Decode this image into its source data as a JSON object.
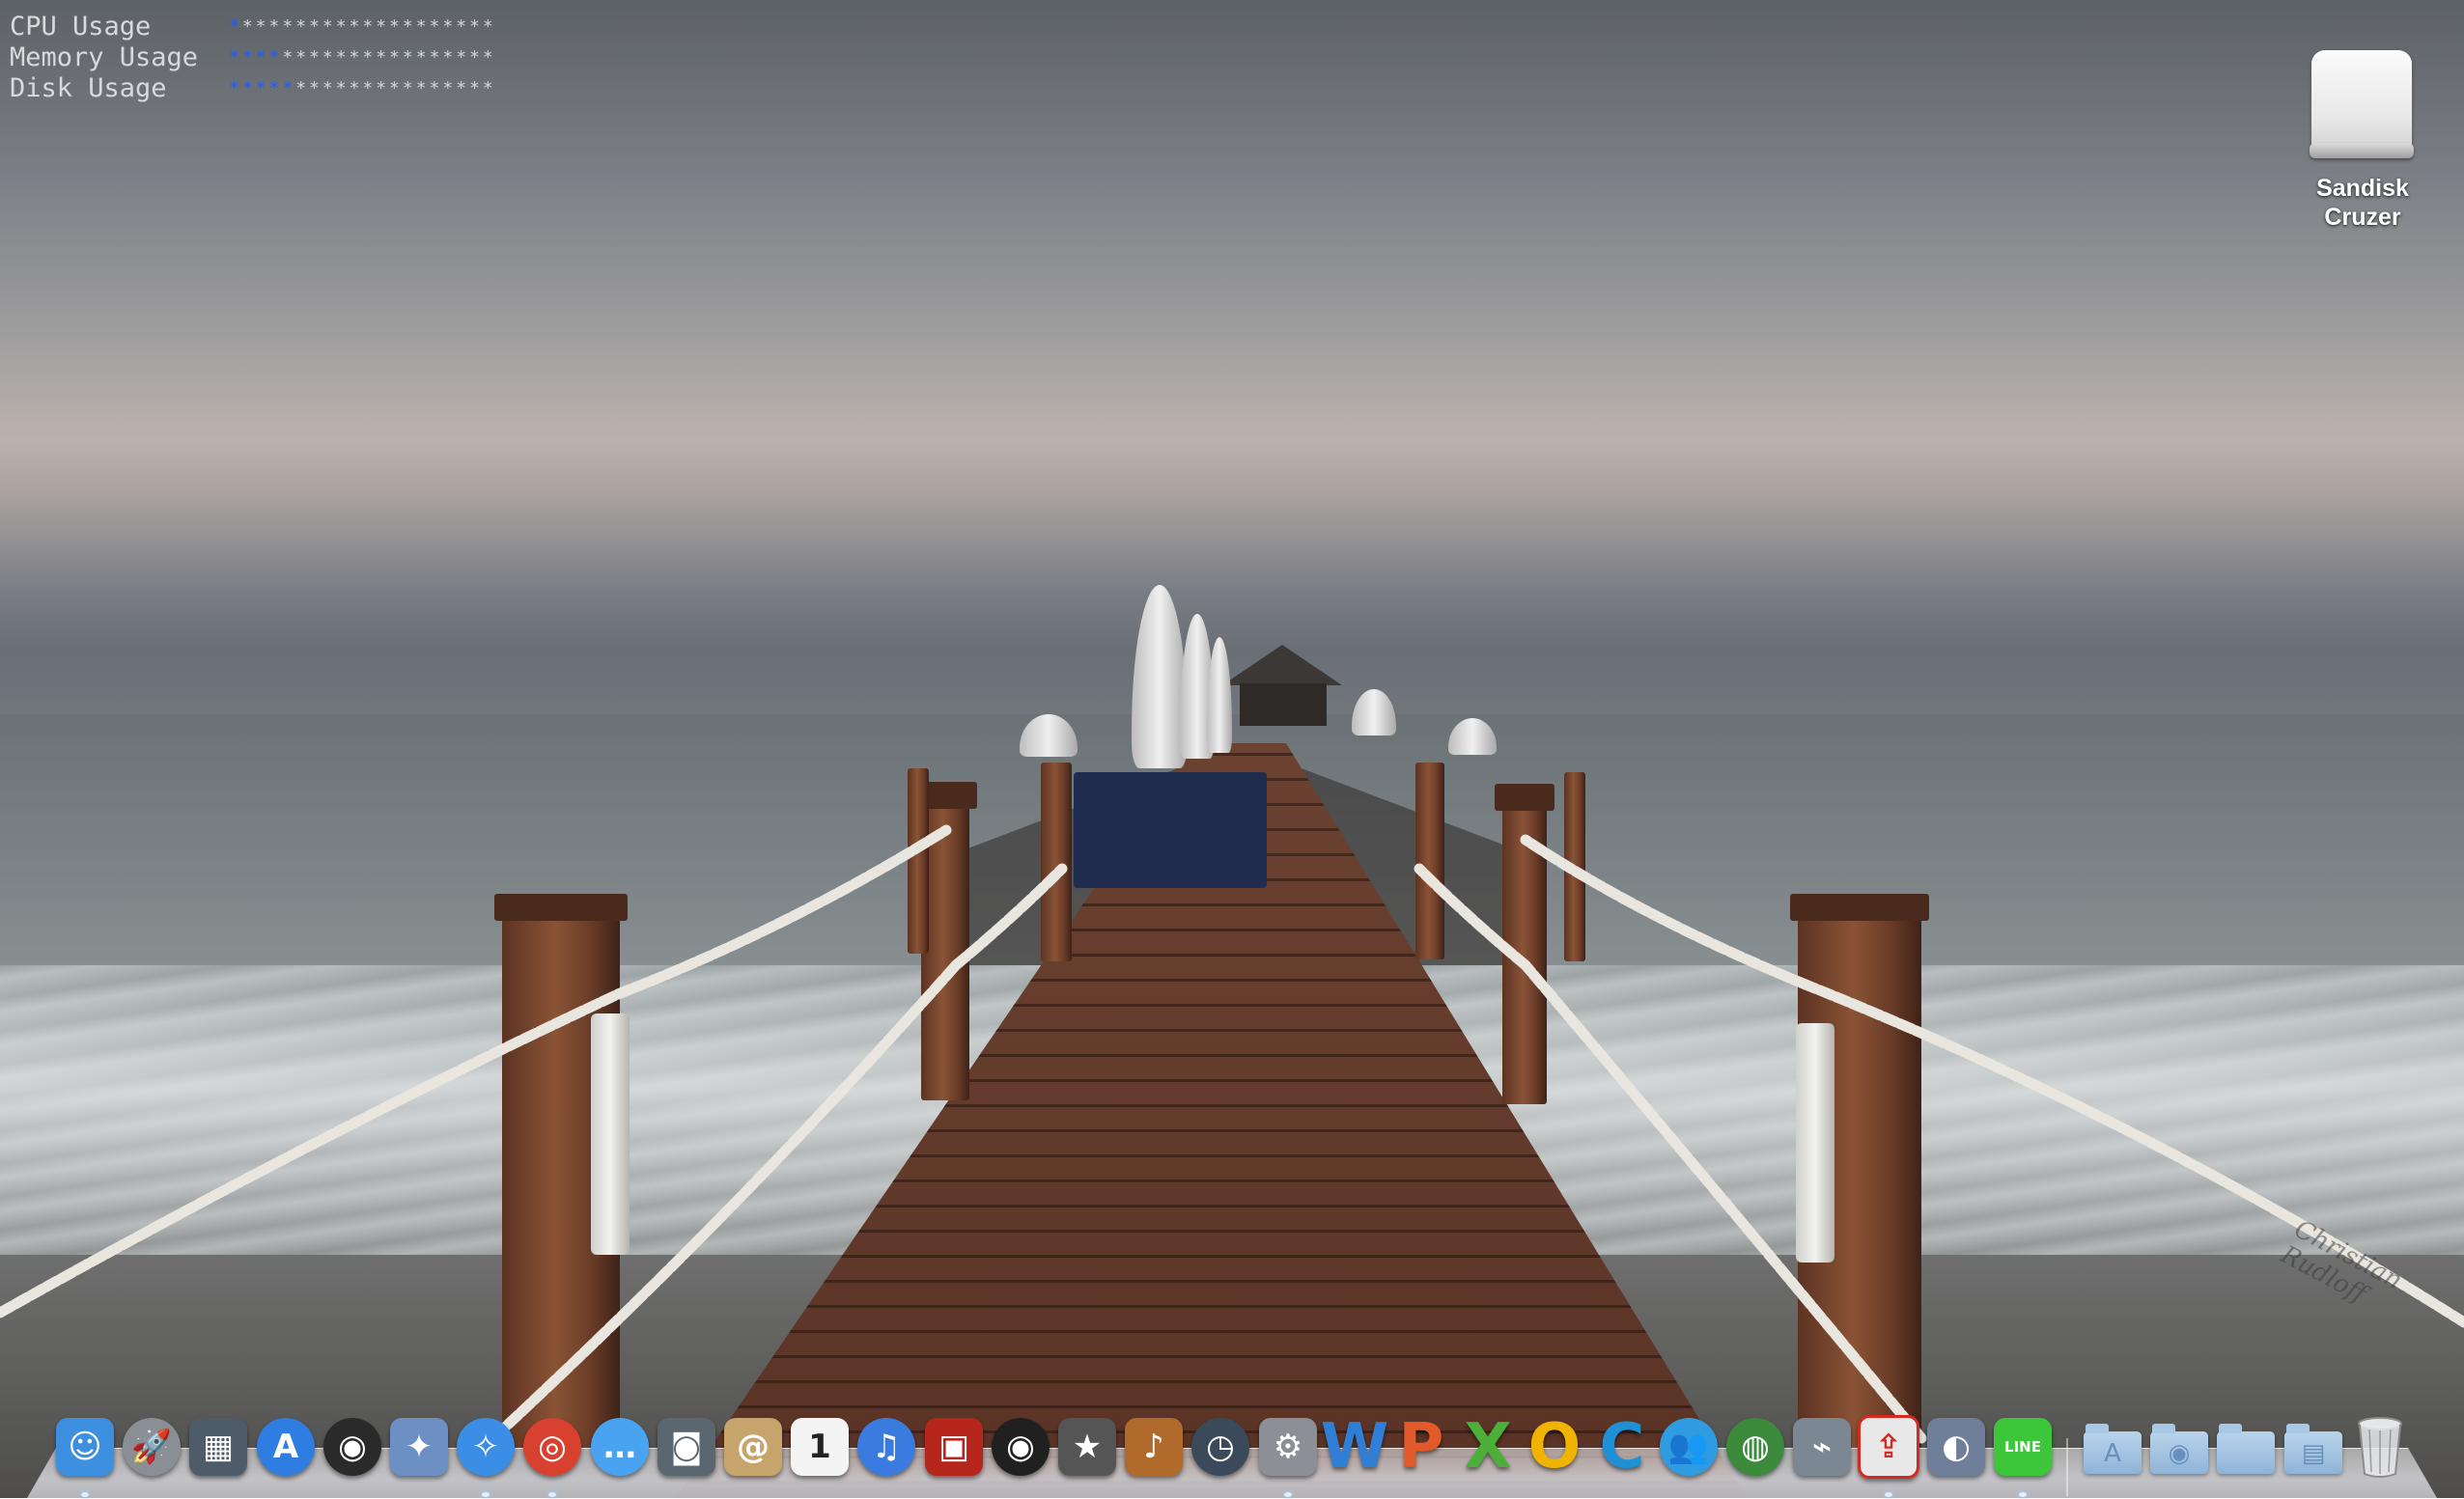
{
  "system_monitor": {
    "rows": [
      {
        "label": "CPU Usage",
        "filled": 1,
        "total": 20
      },
      {
        "label": "Memory Usage",
        "filled": 4,
        "total": 20
      },
      {
        "label": "Disk Usage",
        "filled": 5,
        "total": 20
      }
    ],
    "fill_color": "#1f5bff",
    "empty_color": "#d2d6da"
  },
  "desktop": {
    "drive": {
      "label_line1": "Sandisk",
      "label_line2": "Cruzer",
      "icon": "external-drive-icon"
    },
    "wallpaper": {
      "signature": "Christian Rudloff"
    }
  },
  "dock": {
    "apps": [
      {
        "name": "finder-icon",
        "glyph": "☺",
        "bg": "#3d8fe0",
        "running": true
      },
      {
        "name": "launchpad-icon",
        "glyph": "🚀",
        "bg": "#8a8f96",
        "round": true
      },
      {
        "name": "mission-control-icon",
        "glyph": "▦",
        "bg": "#4e5c6a"
      },
      {
        "name": "app-store-icon",
        "glyph": "A",
        "bg": "#2f7de1",
        "round": true
      },
      {
        "name": "dashboard-icon",
        "glyph": "◉",
        "bg": "#2a2a2a",
        "round": true
      },
      {
        "name": "preview-icon",
        "glyph": "✦",
        "bg": "#6c8fc4"
      },
      {
        "name": "safari-icon",
        "glyph": "✧",
        "bg": "#3a8ee6",
        "round": true,
        "running": true
      },
      {
        "name": "chrome-icon",
        "glyph": "◎",
        "bg": "#d8412f",
        "round": true,
        "running": true
      },
      {
        "name": "messages-icon",
        "glyph": "…",
        "bg": "#4aa3f0",
        "round": true
      },
      {
        "name": "facetime-icon",
        "glyph": "◙",
        "bg": "#5b6770"
      },
      {
        "name": "contacts-icon",
        "glyph": "@",
        "bg": "#c7a46b"
      },
      {
        "name": "calendar-icon",
        "glyph": "1",
        "bg": "#f4f4f4",
        "fg": "#222"
      },
      {
        "name": "itunes-icon",
        "glyph": "♫",
        "bg": "#3a7be0",
        "round": true
      },
      {
        "name": "photo-booth-icon",
        "glyph": "▣",
        "bg": "#b7261c"
      },
      {
        "name": "aperture-icon",
        "glyph": "◉",
        "bg": "#202020",
        "round": true
      },
      {
        "name": "imovie-icon",
        "glyph": "★",
        "bg": "#555"
      },
      {
        "name": "garageband-icon",
        "glyph": "♪",
        "bg": "#b06a2c"
      },
      {
        "name": "time-machine-icon",
        "glyph": "◷",
        "bg": "#3b4a5a",
        "round": true
      },
      {
        "name": "system-preferences-icon",
        "glyph": "⚙",
        "bg": "#8c9096",
        "running": true
      },
      {
        "name": "word-icon",
        "letter": "W",
        "color": "#2f7fd6"
      },
      {
        "name": "powerpoint-icon",
        "letter": "P",
        "color": "#e35a2a"
      },
      {
        "name": "excel-icon",
        "letter": "X",
        "color": "#4caf3a"
      },
      {
        "name": "outlook-icon",
        "letter": "O",
        "color": "#f0b400"
      },
      {
        "name": "communicator-icon",
        "letter": "C",
        "color": "#1f8fd6"
      },
      {
        "name": "messenger-icon",
        "glyph": "👥",
        "bg": "#2f9be0",
        "round": true
      },
      {
        "name": "network-globe-icon",
        "glyph": "◍",
        "bg": "#3c8a3c",
        "round": true
      },
      {
        "name": "satellite-dish-icon",
        "glyph": "⌁",
        "bg": "#7b8792"
      },
      {
        "name": "share-upload-icon",
        "glyph": "⇪",
        "bg": "#e8e8e8",
        "fg": "#d42a1f",
        "border": "#d42a1f",
        "running": true
      },
      {
        "name": "image-capture-icon",
        "glyph": "◐",
        "bg": "#6f7f9a"
      },
      {
        "name": "line-icon",
        "glyph": "LINE",
        "bg": "#3ec63a",
        "small": true,
        "running": true
      }
    ],
    "stacks": [
      {
        "name": "applications-folder-icon",
        "mark": "A"
      },
      {
        "name": "documents-folder-icon",
        "mark": "◉"
      },
      {
        "name": "downloads-folder-icon",
        "mark": ""
      },
      {
        "name": "screenshot-stack-icon",
        "mark": "▤"
      }
    ],
    "trash": {
      "name": "trash-icon"
    }
  }
}
